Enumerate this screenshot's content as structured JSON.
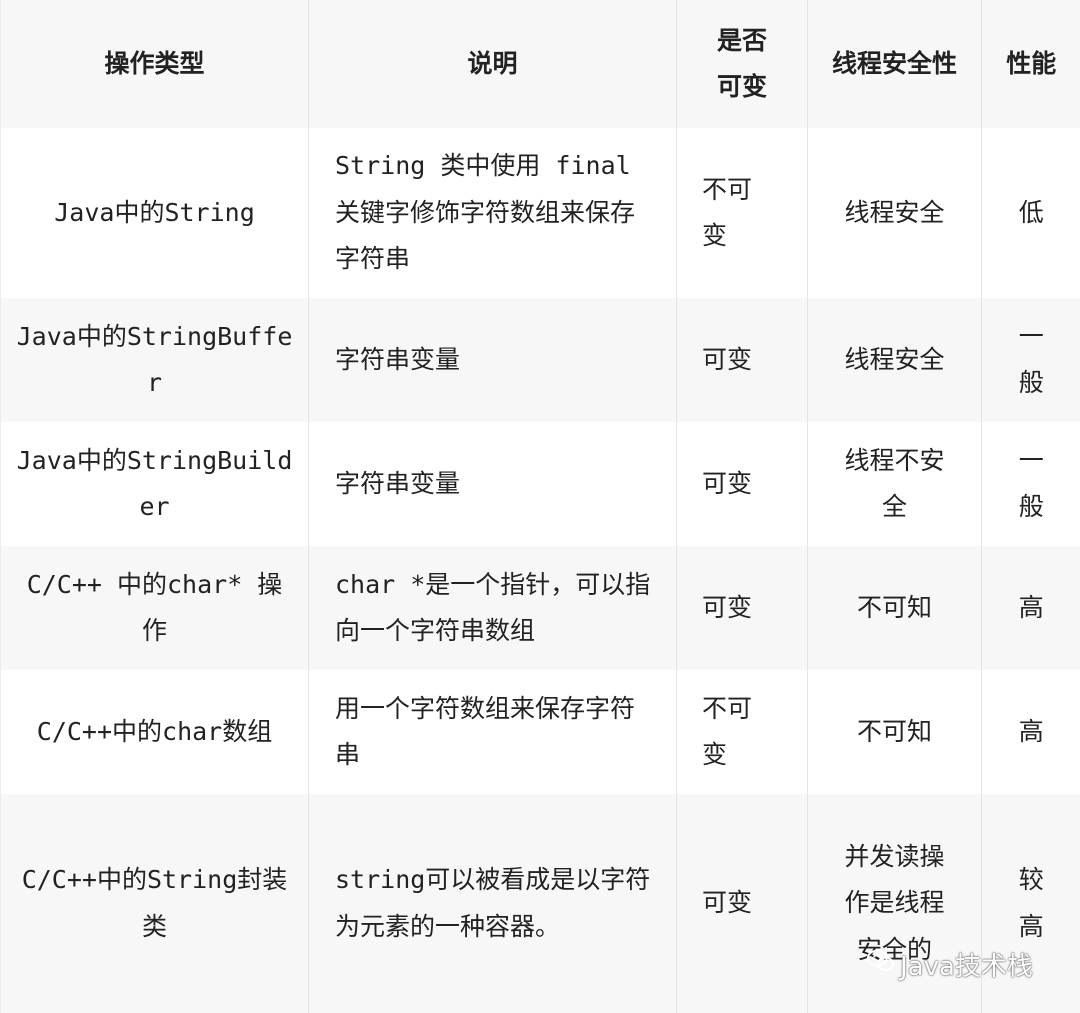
{
  "headers": [
    "操作类型",
    "说明",
    "是否可变",
    "线程安全性",
    "性能"
  ],
  "rows": [
    {
      "type": "Java中的String",
      "desc": "String 类中使用 final 关键字修饰字符数组来保存字符串",
      "mutable": "不可变",
      "thread_safety": "线程安全",
      "performance": "低"
    },
    {
      "type": "Java中的StringBuffer",
      "desc": "字符串变量",
      "mutable": "可变",
      "thread_safety": "线程安全",
      "performance": "一般"
    },
    {
      "type": "Java中的StringBuilder",
      "desc": "字符串变量",
      "mutable": "可变",
      "thread_safety": "线程不安全",
      "performance": "一般"
    },
    {
      "type": "C/C++ 中的char* 操作",
      "desc": "char *是一个指针，可以指向一个字符串数组",
      "mutable": "可变",
      "thread_safety": "不可知",
      "performance": "高"
    },
    {
      "type": "C/C++中的char数组",
      "desc": "用一个字符数组来保存字符串",
      "mutable": "不可变",
      "thread_safety": "不可知",
      "performance": "高"
    },
    {
      "type": "C/C++中的String封装类",
      "desc": "string可以被看成是以字符\n为元素的一种容器。",
      "mutable": "可变",
      "thread_safety": "并发读操作是线程安全的",
      "performance": "较高"
    }
  ],
  "watermark": {
    "text": "Java技术栈",
    "icon": "wechat-icon"
  }
}
